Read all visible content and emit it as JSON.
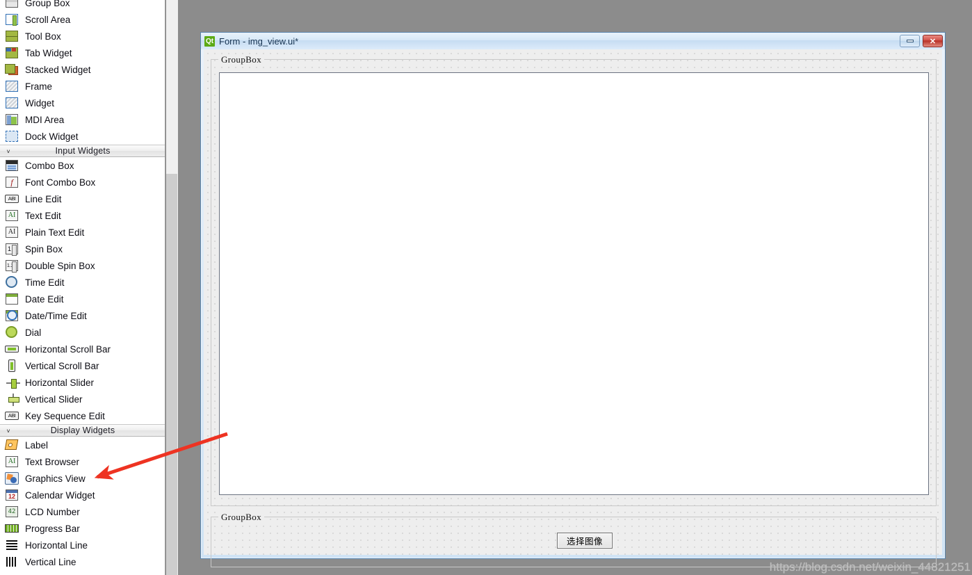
{
  "widget_box": {
    "sections": [
      {
        "label": "",
        "collapsed_chevron": "",
        "items": [
          {
            "label": "Group Box",
            "icon": "group-box-icon"
          },
          {
            "label": "Scroll Area",
            "icon": "scroll-area-icon"
          },
          {
            "label": "Tool Box",
            "icon": "tool-box-icon"
          },
          {
            "label": "Tab Widget",
            "icon": "tab-widget-icon"
          },
          {
            "label": "Stacked Widget",
            "icon": "stacked-widget-icon"
          },
          {
            "label": "Frame",
            "icon": "frame-icon"
          },
          {
            "label": "Widget",
            "icon": "widget-icon"
          },
          {
            "label": "MDI Area",
            "icon": "mdi-area-icon"
          },
          {
            "label": "Dock Widget",
            "icon": "dock-widget-icon"
          }
        ]
      },
      {
        "label": "Input Widgets",
        "collapsed_chevron": "˅",
        "items": [
          {
            "label": "Combo Box",
            "icon": "combo-box-icon"
          },
          {
            "label": "Font Combo Box",
            "icon": "font-combo-box-icon"
          },
          {
            "label": "Line Edit",
            "icon": "line-edit-icon"
          },
          {
            "label": "Text Edit",
            "icon": "text-edit-icon"
          },
          {
            "label": "Plain Text Edit",
            "icon": "plain-text-edit-icon"
          },
          {
            "label": "Spin Box",
            "icon": "spin-box-icon"
          },
          {
            "label": "Double Spin Box",
            "icon": "double-spin-box-icon"
          },
          {
            "label": "Time Edit",
            "icon": "time-edit-icon"
          },
          {
            "label": "Date Edit",
            "icon": "date-edit-icon"
          },
          {
            "label": "Date/Time Edit",
            "icon": "date-time-edit-icon"
          },
          {
            "label": "Dial",
            "icon": "dial-icon"
          },
          {
            "label": "Horizontal Scroll Bar",
            "icon": "horizontal-scroll-bar-icon"
          },
          {
            "label": "Vertical Scroll Bar",
            "icon": "vertical-scroll-bar-icon"
          },
          {
            "label": "Horizontal Slider",
            "icon": "horizontal-slider-icon"
          },
          {
            "label": "Vertical Slider",
            "icon": "vertical-slider-icon"
          },
          {
            "label": "Key Sequence Edit",
            "icon": "key-sequence-edit-icon"
          }
        ]
      },
      {
        "label": "Display Widgets",
        "collapsed_chevron": "˅",
        "items": [
          {
            "label": "Label",
            "icon": "label-icon"
          },
          {
            "label": "Text Browser",
            "icon": "text-browser-icon"
          },
          {
            "label": "Graphics View",
            "icon": "graphics-view-icon"
          },
          {
            "label": "Calendar Widget",
            "icon": "calendar-widget-icon"
          },
          {
            "label": "LCD Number",
            "icon": "lcd-number-icon"
          },
          {
            "label": "Progress Bar",
            "icon": "progress-bar-icon"
          },
          {
            "label": "Horizontal Line",
            "icon": "horizontal-line-icon"
          },
          {
            "label": "Vertical Line",
            "icon": "vertical-line-icon"
          }
        ]
      }
    ],
    "icon_glyphs": {
      "line_edit": "ABI",
      "key_sequence_edit": "ABI",
      "text_edit": "AI",
      "plain_text_edit": "AI",
      "text_browser": "AI",
      "spin_box": "1",
      "double_spin_box": "1.2",
      "font_combo_box": "f",
      "lcd_number": "42",
      "calendar_widget": "12"
    }
  },
  "form_window": {
    "title": "Form - img_view.ui*",
    "app_logo_text": "Qt",
    "minimize_label": "",
    "close_label": "✕",
    "groupbox_top_title": "GroupBox",
    "groupbox_bottom_title": "GroupBox",
    "select_image_button": "选择图像"
  },
  "annotation": {
    "arrow_color": "#ee3322",
    "arrow_target": "Graphics View"
  },
  "watermark": {
    "text": "https://blog.csdn.net/weixin_44821251"
  },
  "colors": {
    "qt_green": "#5caa15",
    "title_bar": "#d7e8f8",
    "form_bg": "#eeeeee",
    "canvas_white": "#ffffff",
    "desktop_gray": "#8c8c8c",
    "arrow_red": "#ee3322"
  }
}
